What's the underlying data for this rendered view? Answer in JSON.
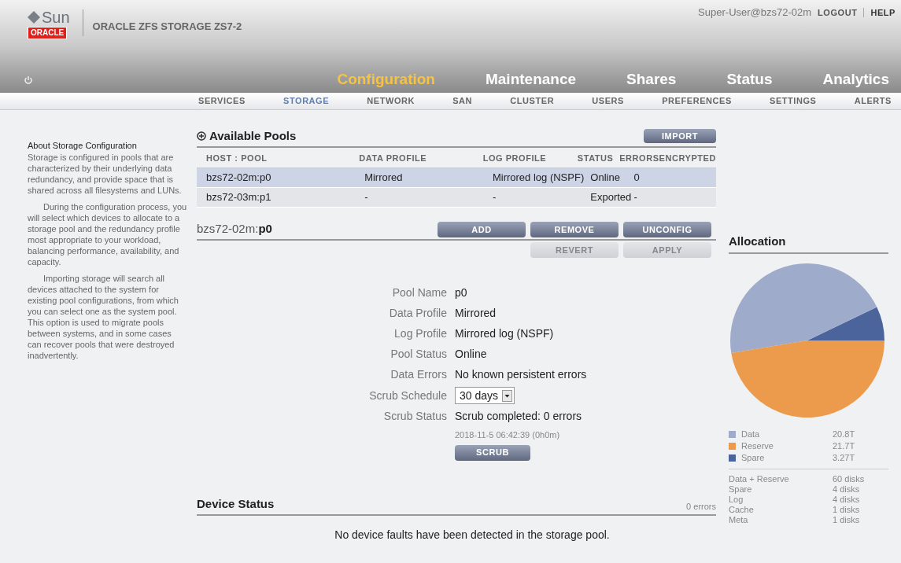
{
  "header": {
    "brand": "Sun",
    "oracle_badge": "ORACLE",
    "product": "ORACLE ZFS STORAGE ZS7-2",
    "user": "Super-User@bzs72-02m",
    "logout": "LOGOUT",
    "help": "HELP"
  },
  "main_tabs": [
    {
      "label": "Configuration",
      "selected": true
    },
    {
      "label": "Maintenance",
      "selected": false
    },
    {
      "label": "Shares",
      "selected": false
    },
    {
      "label": "Status",
      "selected": false
    },
    {
      "label": "Analytics",
      "selected": false
    }
  ],
  "sub_tabs": [
    {
      "label": "SERVICES",
      "selected": false
    },
    {
      "label": "STORAGE",
      "selected": true
    },
    {
      "label": "NETWORK",
      "selected": false
    },
    {
      "label": "SAN",
      "selected": false
    },
    {
      "label": "CLUSTER",
      "selected": false
    },
    {
      "label": "USERS",
      "selected": false
    },
    {
      "label": "PREFERENCES",
      "selected": false
    },
    {
      "label": "SETTINGS",
      "selected": false
    },
    {
      "label": "ALERTS",
      "selected": false
    }
  ],
  "sidebar": {
    "title": "About Storage Configuration",
    "paragraphs": [
      "Storage is configured in pools that are characterized by their underlying data redundancy, and provide space that is shared across all filesystems and LUNs.",
      "During the configuration process, you will select which devices to allocate to a storage pool and the redundancy profile most appropriate to your workload, balancing performance, availability, and capacity.",
      "Importing storage will search all devices attached to the system for existing pool configurations, from which you can select one as the system pool. This option is used to migrate pools between systems, and in some cases can recover pools that were destroyed inadvertently."
    ]
  },
  "pools": {
    "title": "Available Pools",
    "import_button": "IMPORT",
    "columns": [
      "HOST : POOL",
      "DATA PROFILE",
      "LOG PROFILE",
      "STATUS",
      "ERRORS",
      "ENCRYPTED"
    ],
    "rows": [
      {
        "selected": true,
        "cells": [
          "bzs72-02m:p0",
          "Mirrored",
          "Mirrored log (NSPF)",
          "Online",
          "0",
          ""
        ]
      },
      {
        "selected": false,
        "cells": [
          "bzs72-03m:p1",
          "-",
          "-",
          "Exported",
          "-",
          ""
        ]
      }
    ]
  },
  "pool_detail": {
    "host": "bzs72-02m:",
    "pool": "p0",
    "buttons": [
      {
        "label": "ADD",
        "disabled": false
      },
      {
        "label": "REMOVE",
        "disabled": false
      },
      {
        "label": "UNCONFIG",
        "disabled": false
      }
    ],
    "edit_buttons": [
      {
        "label": "REVERT",
        "disabled": true
      },
      {
        "label": "APPLY",
        "disabled": true
      }
    ],
    "fields": [
      {
        "kind": "text",
        "label": "Pool Name",
        "value": "p0"
      },
      {
        "kind": "text",
        "label": "Data Profile",
        "value": "Mirrored"
      },
      {
        "kind": "text",
        "label": "Log Profile",
        "value": "Mirrored log (NSPF)"
      },
      {
        "kind": "text",
        "label": "Pool Status",
        "value": "Online"
      },
      {
        "kind": "text",
        "label": "Data Errors",
        "value": "No known persistent errors"
      },
      {
        "kind": "select",
        "label": "Scrub Schedule",
        "value": "30 days"
      },
      {
        "kind": "text",
        "label": "Scrub Status",
        "value": "Scrub completed: 0 errors"
      }
    ],
    "scrub_time": "2018-11-5 06:42:39 (0h0m)",
    "scrub_button": "SCRUB"
  },
  "device_status": {
    "title": "Device Status",
    "count": "0 errors",
    "message": "No device faults have been detected in the storage pool."
  },
  "allocation": {
    "title": "Allocation",
    "chart_data": {
      "type": "pie",
      "categories": [
        "Data",
        "Reserve",
        "Spare"
      ],
      "values": [
        45.44,
        47.41,
        7.15
      ]
    },
    "legend": [
      {
        "value": "20.8T",
        "color": "#9eabcb"
      },
      {
        "value": "21.7T",
        "color": "#ec9a4c"
      },
      {
        "value": "3.27T",
        "color": "#4b649c"
      }
    ],
    "disks": [
      {
        "name": "Data + Reserve",
        "value": "60 disks"
      },
      {
        "name": "Spare",
        "value": "4 disks"
      },
      {
        "name": "Log",
        "value": "4 disks"
      },
      {
        "name": "Cache",
        "value": "1 disks"
      },
      {
        "name": "Meta",
        "value": "1 disks"
      }
    ]
  }
}
